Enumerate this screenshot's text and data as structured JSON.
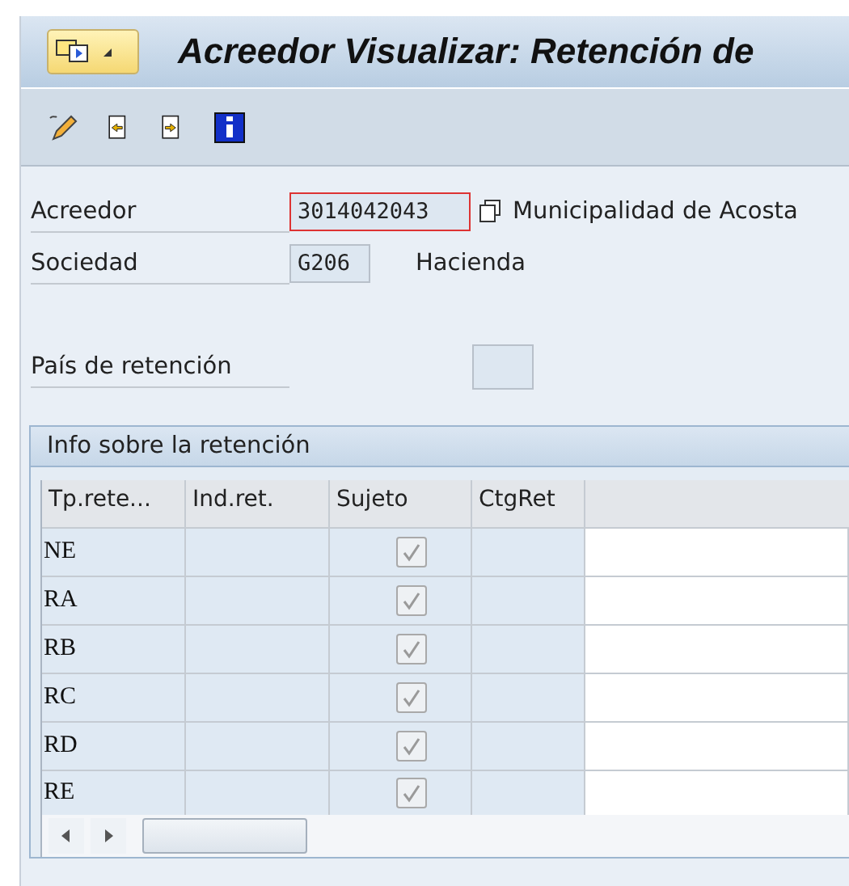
{
  "window": {
    "title": "Acreedor Visualizar: Retención de"
  },
  "fields": [
    {
      "label": "Acreedor",
      "value": "3014042043",
      "focused": true,
      "description": "Municipalidad de Acosta"
    },
    {
      "label": "Sociedad",
      "value": "G206",
      "focused": false,
      "description": "Hacienda"
    }
  ],
  "country_field": {
    "label": "País de retención"
  },
  "group": {
    "title": "Info sobre la retención"
  },
  "table": {
    "columns": [
      "Tp.rete...",
      "Ind.ret.",
      "Sujeto",
      "CtgRet"
    ],
    "rows": [
      {
        "type": "NE",
        "checked": true
      },
      {
        "type": "RA",
        "checked": true
      },
      {
        "type": "RB",
        "checked": true
      },
      {
        "type": "RC",
        "checked": true
      },
      {
        "type": "RD",
        "checked": true
      },
      {
        "type": "RE",
        "checked": true
      }
    ]
  }
}
